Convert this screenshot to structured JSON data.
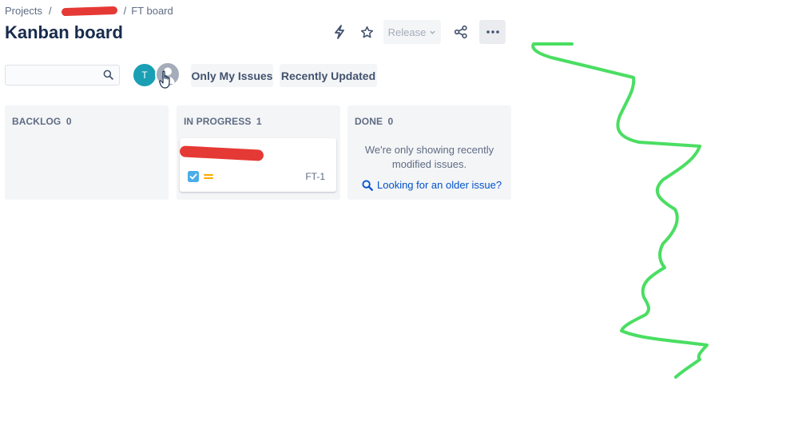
{
  "breadcrumb": {
    "projects": "Projects",
    "separator": "/",
    "board": "FT board"
  },
  "page": {
    "title": "Kanban board"
  },
  "toolbar": {
    "release_label": "Release",
    "icons": [
      "lightning-icon",
      "star-icon",
      "chevron-down-icon",
      "share-icon",
      "more-icon"
    ]
  },
  "filters": {
    "search_placeholder": "",
    "avatar_initial": "T",
    "only_my_issues": "Only My Issues",
    "recently_updated": "Recently Updated"
  },
  "columns": [
    {
      "title": "BACKLOG",
      "count": "0"
    },
    {
      "title": "IN PROGRESS",
      "count": "1"
    },
    {
      "title": "DONE",
      "count": "0"
    }
  ],
  "card": {
    "key": "FT-1"
  },
  "done": {
    "message": "We're only showing recently modified issues.",
    "link": "Looking for an older issue?"
  },
  "colors": {
    "accent": "#0052cc",
    "avatar": "#1a9fb5",
    "checkbox": "#4bade8",
    "priority": "#ffab00",
    "redaction": "#e53935",
    "annotation": "#4ade62"
  }
}
